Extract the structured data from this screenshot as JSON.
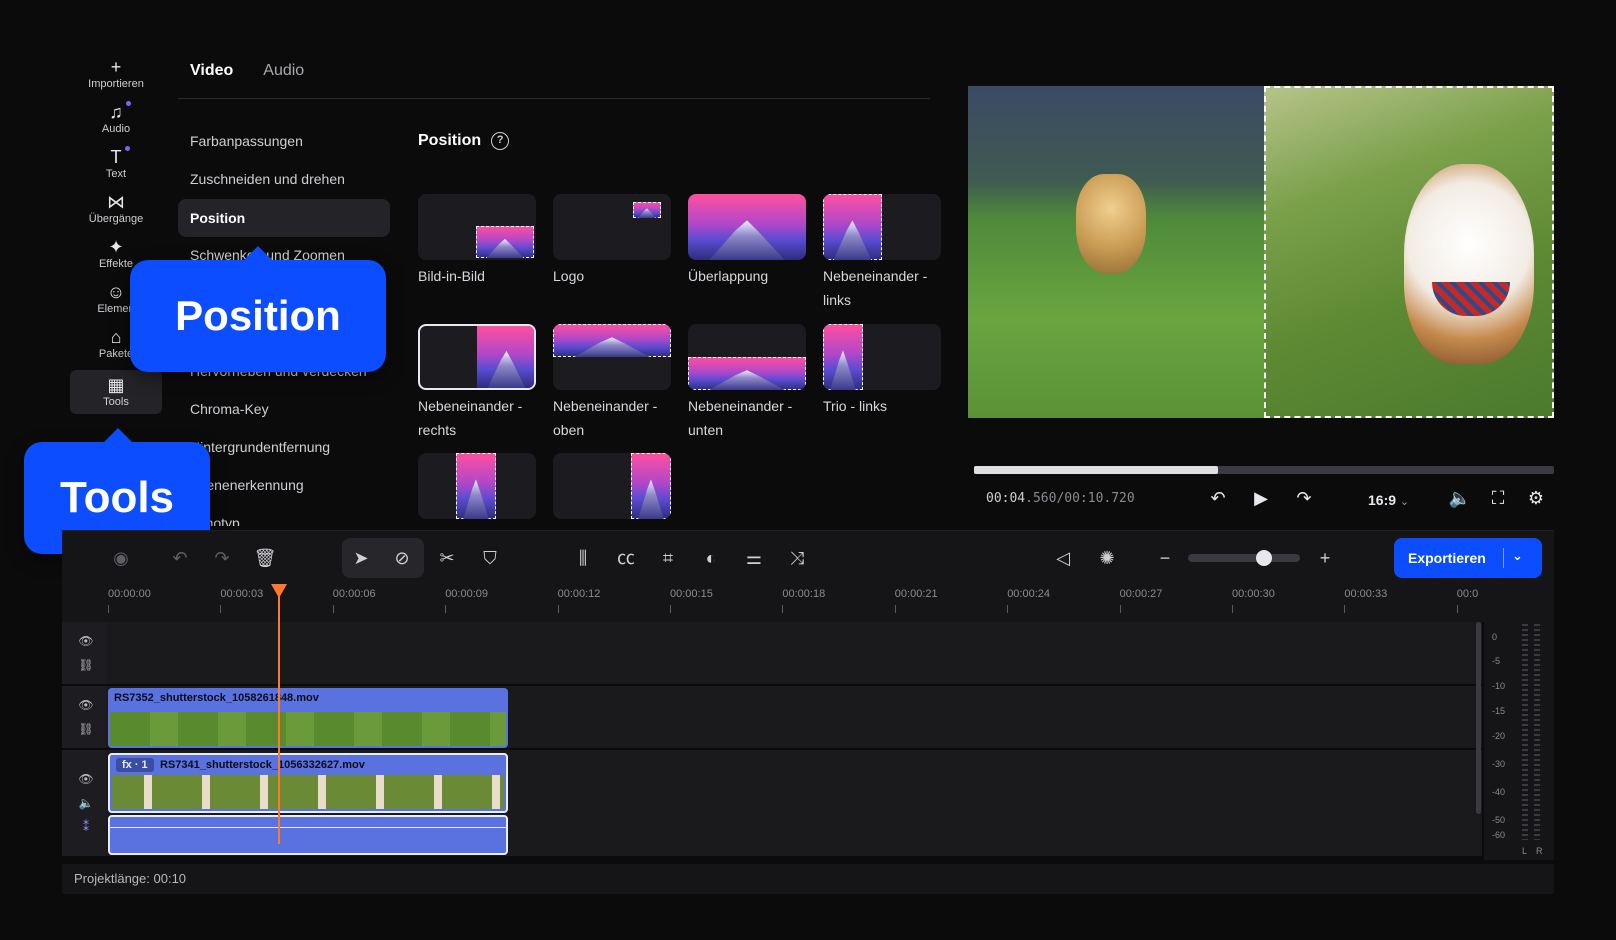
{
  "rail": [
    {
      "icon": "+",
      "label": "Importieren",
      "dot": false
    },
    {
      "icon": "♫",
      "label": "Audio",
      "dot": true
    },
    {
      "icon": "T",
      "label": "Text",
      "dot": true
    },
    {
      "icon": "⋈",
      "label": "Übergänge",
      "dot": false
    },
    {
      "icon": "✦",
      "label": "Effekte",
      "dot": false
    },
    {
      "icon": "☺",
      "label": "Elemen",
      "dot": false
    },
    {
      "icon": "⌂",
      "label": "Pakete",
      "dot": false
    },
    {
      "icon": "▦",
      "label": "Tools",
      "dot": false
    }
  ],
  "tabs": {
    "video": "Video",
    "audio": "Audio"
  },
  "submenu": [
    "Farbanpassungen",
    "Zuschneiden und drehen",
    "Position",
    "Schwenken und Zoomen",
    "",
    "Hervorheben und verdecken",
    "Chroma-Key",
    "Hintergrundentfernung",
    "Szenenerkennung",
    "Lenotyp"
  ],
  "callouts": {
    "position": "Position",
    "tools": "Tools"
  },
  "position": {
    "title": "Position",
    "help": "?",
    "layouts": [
      "Bild-in-Bild",
      "Logo",
      "Überlappung",
      "Nebeneinander - links",
      "Nebeneinander - rechts",
      "Nebeneinander - oben",
      "Nebeneinander - unten",
      "Trio - links"
    ]
  },
  "player": {
    "progress": 0.42,
    "timecode_current": "00:04",
    "timecode_rest": ".560/00:10.720",
    "ratio": "16:9"
  },
  "toolbar": {
    "export_label": "Exportieren"
  },
  "ruler": [
    "00:00:00",
    "00:00:03",
    "00:00:06",
    "00:00:09",
    "00:00:12",
    "00:00:15",
    "00:00:18",
    "00:00:21",
    "00:00:24",
    "00:00:27",
    "00:00:30",
    "00:00:33",
    "00:0"
  ],
  "clips": {
    "clip1": "RS7352_shutterstock_1058261848.mov",
    "clip2": "RS7341_shutterstock_1056332627.mov",
    "fx_badge": "fx · 1"
  },
  "meter": [
    "0",
    "-5",
    "-10",
    "-15",
    "-20",
    "-30",
    "-40",
    "-50",
    "-60"
  ],
  "meter_channels": {
    "left": "L",
    "right": "R"
  },
  "footer": {
    "project_length": "Projektlänge: 00:10"
  },
  "colors": {
    "accent": "#0b4dff",
    "clip": "#5a72e0",
    "playhead": "#ff7a2a"
  }
}
